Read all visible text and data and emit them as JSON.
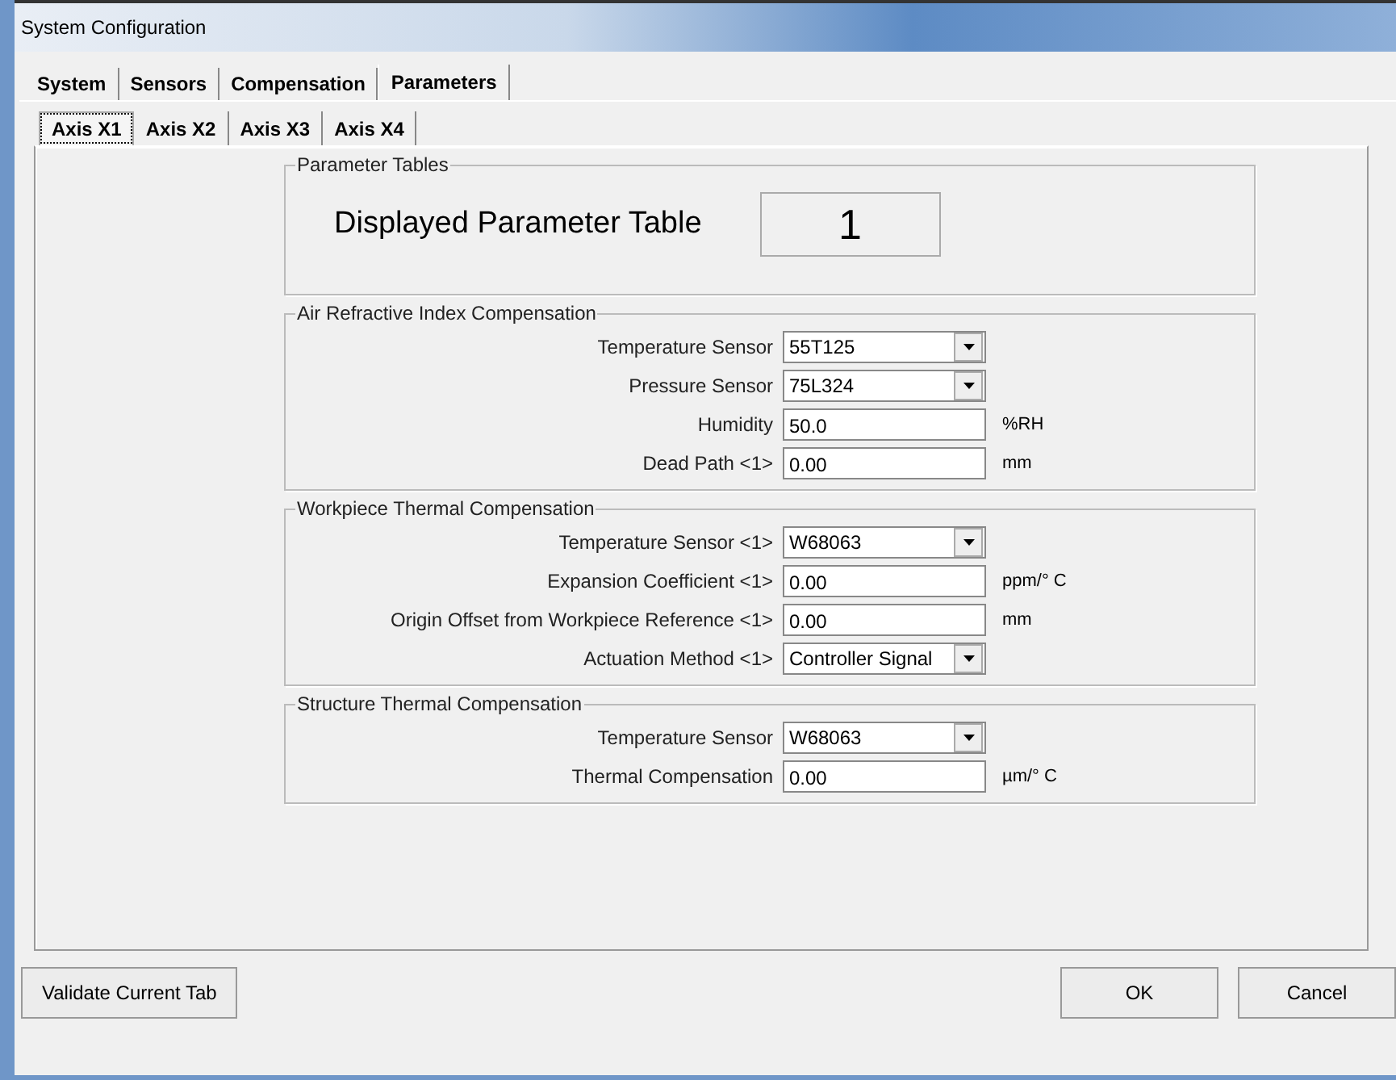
{
  "window": {
    "title": "System Configuration"
  },
  "tabs": [
    {
      "label": "System",
      "selected": false
    },
    {
      "label": "Sensors",
      "selected": false
    },
    {
      "label": "Compensation",
      "selected": false
    },
    {
      "label": "Parameters",
      "selected": true
    }
  ],
  "subtabs": [
    {
      "label": "Axis X1",
      "selected": true
    },
    {
      "label": "Axis X2",
      "selected": false
    },
    {
      "label": "Axis X3",
      "selected": false
    },
    {
      "label": "Axis X4",
      "selected": false
    }
  ],
  "parameter_tables": {
    "title": "Parameter Tables",
    "label": "Displayed Parameter Table",
    "value": "1"
  },
  "groups": [
    {
      "title": "Air Refractive Index Compensation",
      "fields": [
        {
          "label": "Temperature Sensor",
          "kind": "dropdown",
          "value": "55T125"
        },
        {
          "label": "Pressure Sensor",
          "kind": "dropdown",
          "value": "75L324"
        },
        {
          "label": "Humidity",
          "kind": "text",
          "value": "50.0",
          "unit": "%RH"
        },
        {
          "label": "Dead Path <1>",
          "kind": "text",
          "value": "0.00",
          "unit": "mm"
        }
      ]
    },
    {
      "title": "Workpiece Thermal Compensation",
      "fields": [
        {
          "label": "Temperature Sensor <1>",
          "kind": "dropdown",
          "value": "W68063"
        },
        {
          "label": "Expansion Coefficient <1>",
          "kind": "text",
          "value": "0.00",
          "unit": "ppm/° C"
        },
        {
          "label": "Origin Offset from Workpiece Reference <1>",
          "kind": "text",
          "value": "0.00",
          "unit": "mm"
        },
        {
          "label": "Actuation Method <1>",
          "kind": "dropdown",
          "value": "Controller Signal"
        }
      ]
    },
    {
      "title": "Structure Thermal Compensation",
      "fields": [
        {
          "label": "Temperature Sensor",
          "kind": "dropdown",
          "value": "W68063"
        },
        {
          "label": "Thermal Compensation",
          "kind": "text",
          "value": "0.00",
          "unit": "µm/° C"
        }
      ]
    }
  ],
  "footer": {
    "validate_button": "Validate Current Tab",
    "ok_button": "OK",
    "cancel_button": "Cancel"
  }
}
